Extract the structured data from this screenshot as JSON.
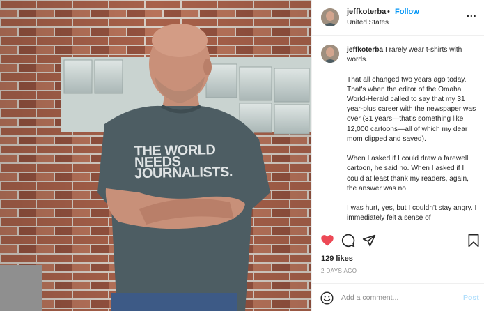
{
  "post": {
    "username": "jeffkoterba",
    "separator": "•",
    "follow_label": "Follow",
    "location": "United States",
    "more_label": "...",
    "shirt_text": [
      "THE WORLD",
      "NEEDS",
      "JOURNALISTS."
    ],
    "caption_paragraphs": [
      "I rarely wear t-shirts with words.",
      "That all changed two years ago today. That's when the editor of the Omaha World-Herald called to say that my 31 year-plus career with the newspaper was over (31 years—that's something like 12,000 cartoons—all of which my dear mom clipped and saved).",
      "When I asked if I could draw a farewell cartoon, he said no. When I asked if I could at least thank my readers, again, the answer was no.",
      "I was hurt, yes, but I couldn't stay angry. I immediately felt a sense of"
    ],
    "likes": "129 likes",
    "date": "2 DAYS AGO",
    "comment_placeholder": "Add a comment...",
    "post_label": "Post",
    "icons": {
      "like": "heart-icon",
      "comment": "comment-icon",
      "share": "share-icon",
      "save": "bookmark-icon",
      "emoji": "emoji-icon"
    },
    "colors": {
      "liked": "#ed4956",
      "link": "#0095f6",
      "post_disabled": "#b2dffc",
      "muted": "#8e8e8e"
    }
  }
}
